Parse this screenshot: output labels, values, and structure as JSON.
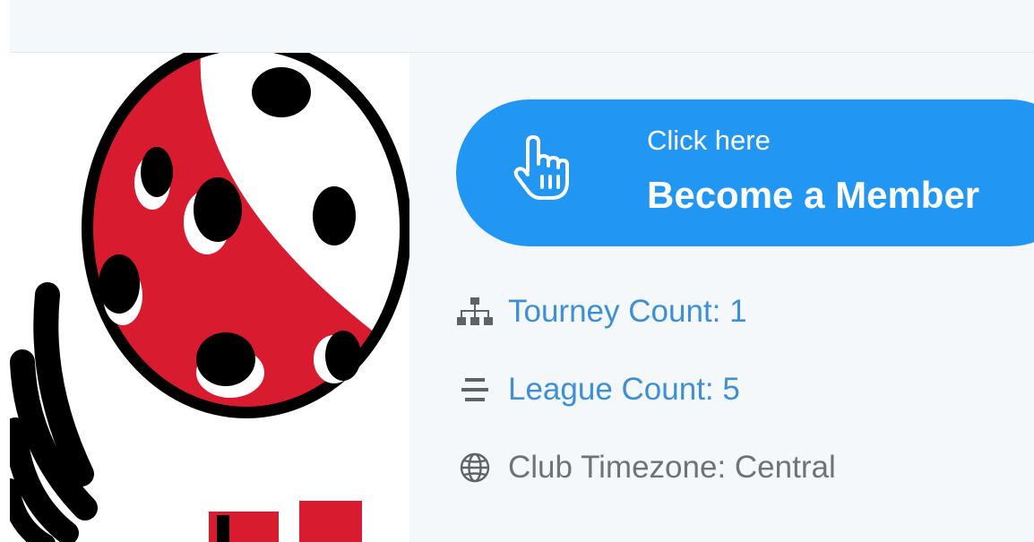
{
  "colors": {
    "header_bg": "#f5f8fa",
    "panel_bg": "#f5f8fa",
    "button_bg": "#2196f3",
    "link": "#3d8fd6",
    "text_muted": "#6e7378",
    "logo_red": "#d81b2f",
    "logo_black": "#000000"
  },
  "logo": {
    "icon": "pickleball-club-logo"
  },
  "member_button": {
    "icon": "pointing-hand-icon",
    "small_label": "Click here",
    "main_label": "Become a Member"
  },
  "stats": [
    {
      "icon": "sitemap-icon",
      "label": "Tourney Count: 1"
    },
    {
      "icon": "list-icon",
      "label": "League Count: 5"
    },
    {
      "icon": "globe-icon",
      "label": "Club Timezone: Central"
    }
  ]
}
